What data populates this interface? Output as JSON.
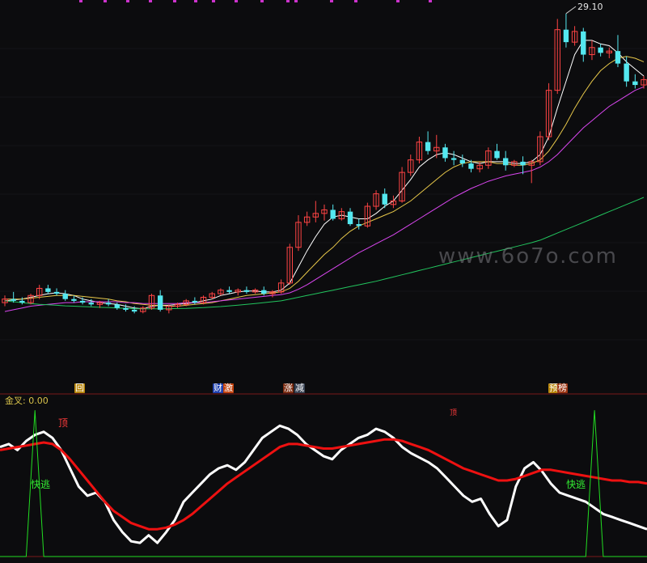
{
  "colors": {
    "background": "#0c0c0e",
    "up_candle": "#ff4444",
    "down_candle": "#54e8f0",
    "ma5": "#ffffff",
    "ma10": "#e8c84a",
    "ma20": "#d946ef",
    "ma60": "#22c55e",
    "signal_white": "#ffffff",
    "signal_red": "#ee1111",
    "escape_green": "#22dd22",
    "marker_magenta": "#cc33cc"
  },
  "price_panel": {
    "high_label": "29.10",
    "watermark": "www.6o7o.com",
    "tags": [
      {
        "text": "回",
        "bg": "#b8860b",
        "fg": "#ffffff"
      },
      {
        "text": "财",
        "bg": "#1e40af",
        "fg": "#ffffff"
      },
      {
        "text": "激",
        "bg": "#c2410c",
        "fg": "#ffffff"
      },
      {
        "text": "涨",
        "bg": "#7c2d12",
        "fg": "#ffffff"
      },
      {
        "text": "减",
        "bg": "#374151",
        "fg": "#ffffff"
      },
      {
        "text": "预",
        "bg": "#b8860b",
        "fg": "#ffffff"
      },
      {
        "text": "榜",
        "bg": "#9a3412",
        "fg": "#ffffff"
      }
    ]
  },
  "indicator_panel": {
    "title": "金叉: 0.00",
    "label_top": "顶",
    "label_top2": "顶",
    "label_escape": "快逃"
  },
  "chart_data": [
    {
      "type": "candlestick",
      "title": "",
      "ylabel": "",
      "ylim": [
        11.5,
        29.5
      ],
      "annotations": [
        "29.10"
      ],
      "candles": [
        {
          "o": 12.9,
          "h": 13.3,
          "l": 12.7,
          "c": 13.1
        },
        {
          "o": 13.1,
          "h": 13.5,
          "l": 12.9,
          "c": 13.0
        },
        {
          "o": 13.0,
          "h": 13.2,
          "l": 12.8,
          "c": 12.9
        },
        {
          "o": 12.9,
          "h": 13.4,
          "l": 12.8,
          "c": 13.3
        },
        {
          "o": 13.3,
          "h": 13.9,
          "l": 13.1,
          "c": 13.7
        },
        {
          "o": 13.7,
          "h": 13.9,
          "l": 13.4,
          "c": 13.5
        },
        {
          "o": 13.5,
          "h": 13.7,
          "l": 13.3,
          "c": 13.4
        },
        {
          "o": 13.4,
          "h": 13.6,
          "l": 13.0,
          "c": 13.1
        },
        {
          "o": 13.1,
          "h": 13.3,
          "l": 12.9,
          "c": 13.0
        },
        {
          "o": 13.0,
          "h": 13.2,
          "l": 12.8,
          "c": 12.9
        },
        {
          "o": 12.9,
          "h": 13.1,
          "l": 12.7,
          "c": 12.8
        },
        {
          "o": 12.8,
          "h": 13.0,
          "l": 12.6,
          "c": 12.9
        },
        {
          "o": 12.9,
          "h": 13.1,
          "l": 12.7,
          "c": 12.8
        },
        {
          "o": 12.8,
          "h": 12.9,
          "l": 12.5,
          "c": 12.6
        },
        {
          "o": 12.6,
          "h": 12.8,
          "l": 12.4,
          "c": 12.5
        },
        {
          "o": 12.5,
          "h": 12.7,
          "l": 12.3,
          "c": 12.4
        },
        {
          "o": 12.4,
          "h": 12.7,
          "l": 12.3,
          "c": 12.6
        },
        {
          "o": 12.6,
          "h": 13.4,
          "l": 12.5,
          "c": 13.3
        },
        {
          "o": 13.3,
          "h": 13.6,
          "l": 12.4,
          "c": 12.5
        },
        {
          "o": 12.5,
          "h": 12.8,
          "l": 12.3,
          "c": 12.7
        },
        {
          "o": 12.7,
          "h": 12.9,
          "l": 12.6,
          "c": 12.8
        },
        {
          "o": 12.8,
          "h": 13.1,
          "l": 12.7,
          "c": 13.0
        },
        {
          "o": 13.0,
          "h": 13.2,
          "l": 12.8,
          "c": 12.9
        },
        {
          "o": 12.9,
          "h": 13.3,
          "l": 12.8,
          "c": 13.2
        },
        {
          "o": 13.2,
          "h": 13.5,
          "l": 13.1,
          "c": 13.4
        },
        {
          "o": 13.4,
          "h": 13.7,
          "l": 13.3,
          "c": 13.6
        },
        {
          "o": 13.6,
          "h": 13.8,
          "l": 13.4,
          "c": 13.5
        },
        {
          "o": 13.5,
          "h": 13.7,
          "l": 13.3,
          "c": 13.6
        },
        {
          "o": 13.6,
          "h": 13.8,
          "l": 13.4,
          "c": 13.5
        },
        {
          "o": 13.5,
          "h": 13.7,
          "l": 13.4,
          "c": 13.6
        },
        {
          "o": 13.6,
          "h": 13.8,
          "l": 13.3,
          "c": 13.4
        },
        {
          "o": 13.4,
          "h": 13.6,
          "l": 13.2,
          "c": 13.5
        },
        {
          "o": 13.5,
          "h": 14.2,
          "l": 13.4,
          "c": 14.0
        },
        {
          "o": 14.0,
          "h": 16.2,
          "l": 13.9,
          "c": 16.0
        },
        {
          "o": 16.0,
          "h": 17.8,
          "l": 15.8,
          "c": 17.4
        },
        {
          "o": 17.4,
          "h": 18.0,
          "l": 17.2,
          "c": 17.7
        },
        {
          "o": 17.7,
          "h": 18.6,
          "l": 17.4,
          "c": 17.9
        },
        {
          "o": 17.9,
          "h": 18.4,
          "l": 17.5,
          "c": 18.1
        },
        {
          "o": 18.1,
          "h": 18.4,
          "l": 17.5,
          "c": 17.6
        },
        {
          "o": 17.6,
          "h": 18.2,
          "l": 17.5,
          "c": 18.0
        },
        {
          "o": 18.0,
          "h": 18.2,
          "l": 17.2,
          "c": 17.3
        },
        {
          "o": 17.3,
          "h": 17.6,
          "l": 17.0,
          "c": 17.2
        },
        {
          "o": 17.2,
          "h": 18.5,
          "l": 17.1,
          "c": 18.3
        },
        {
          "o": 18.3,
          "h": 19.2,
          "l": 18.1,
          "c": 19.0
        },
        {
          "o": 19.0,
          "h": 19.3,
          "l": 18.2,
          "c": 18.4
        },
        {
          "o": 18.4,
          "h": 18.9,
          "l": 18.2,
          "c": 18.6
        },
        {
          "o": 18.6,
          "h": 20.5,
          "l": 18.5,
          "c": 20.2
        },
        {
          "o": 20.2,
          "h": 21.2,
          "l": 20.0,
          "c": 20.9
        },
        {
          "o": 20.9,
          "h": 22.2,
          "l": 20.7,
          "c": 21.9
        },
        {
          "o": 21.9,
          "h": 22.5,
          "l": 21.2,
          "c": 21.4
        },
        {
          "o": 21.4,
          "h": 22.3,
          "l": 21.0,
          "c": 21.6
        },
        {
          "o": 21.6,
          "h": 21.8,
          "l": 20.8,
          "c": 21.0
        },
        {
          "o": 21.0,
          "h": 21.4,
          "l": 20.6,
          "c": 20.9
        },
        {
          "o": 20.9,
          "h": 21.2,
          "l": 20.5,
          "c": 20.7
        },
        {
          "o": 20.7,
          "h": 20.9,
          "l": 20.2,
          "c": 20.4
        },
        {
          "o": 20.4,
          "h": 20.8,
          "l": 20.2,
          "c": 20.6
        },
        {
          "o": 20.6,
          "h": 21.6,
          "l": 20.4,
          "c": 21.4
        },
        {
          "o": 21.4,
          "h": 21.8,
          "l": 20.9,
          "c": 21.0
        },
        {
          "o": 21.0,
          "h": 21.4,
          "l": 20.3,
          "c": 20.6
        },
        {
          "o": 20.6,
          "h": 20.9,
          "l": 20.5,
          "c": 20.8
        },
        {
          "o": 20.8,
          "h": 21.1,
          "l": 20.1,
          "c": 20.6
        },
        {
          "o": 20.6,
          "h": 20.9,
          "l": 19.6,
          "c": 20.8
        },
        {
          "o": 20.8,
          "h": 22.5,
          "l": 20.6,
          "c": 22.2
        },
        {
          "o": 22.2,
          "h": 25.2,
          "l": 22.0,
          "c": 24.8
        },
        {
          "o": 24.8,
          "h": 28.8,
          "l": 24.6,
          "c": 28.2
        },
        {
          "o": 28.2,
          "h": 29.1,
          "l": 27.2,
          "c": 27.5
        },
        {
          "o": 27.5,
          "h": 28.4,
          "l": 27.3,
          "c": 28.1
        },
        {
          "o": 28.1,
          "h": 28.3,
          "l": 26.4,
          "c": 26.8
        },
        {
          "o": 26.8,
          "h": 27.6,
          "l": 26.5,
          "c": 27.2
        },
        {
          "o": 27.2,
          "h": 27.4,
          "l": 26.7,
          "c": 26.9
        },
        {
          "o": 26.9,
          "h": 27.2,
          "l": 26.6,
          "c": 27.0
        },
        {
          "o": 27.0,
          "h": 27.9,
          "l": 26.1,
          "c": 26.3
        },
        {
          "o": 26.3,
          "h": 26.7,
          "l": 25.0,
          "c": 25.3
        },
        {
          "o": 25.3,
          "h": 25.7,
          "l": 24.9,
          "c": 25.1
        },
        {
          "o": 25.1,
          "h": 25.6,
          "l": 24.9,
          "c": 25.4
        }
      ],
      "series": [
        {
          "name": "",
          "color": "#ffffff",
          "values": [
            13.0,
            13.05,
            13.1,
            13.2,
            13.3,
            13.4,
            13.45,
            13.4,
            13.3,
            13.1,
            13.0,
            12.9,
            12.85,
            12.8,
            12.7,
            12.6,
            12.55,
            12.7,
            12.75,
            12.75,
            12.8,
            12.85,
            12.9,
            13.0,
            13.1,
            13.3,
            13.4,
            13.5,
            13.55,
            13.55,
            13.5,
            13.5,
            13.6,
            14.0,
            14.9,
            15.8,
            16.6,
            17.3,
            17.7,
            17.8,
            17.7,
            17.6,
            17.6,
            17.9,
            18.3,
            18.6,
            19.2,
            19.8,
            20.5,
            20.9,
            21.2,
            21.3,
            21.2,
            21.0,
            20.8,
            20.7,
            20.8,
            20.8,
            20.8,
            20.7,
            20.7,
            20.8,
            21.2,
            22.2,
            23.8,
            25.3,
            26.8,
            27.6,
            27.6,
            27.4,
            27.3,
            26.9,
            26.4,
            26.0,
            25.6
          ]
        },
        {
          "name": "",
          "color": "#e8c84a",
          "values": [
            13.1,
            13.1,
            13.1,
            13.15,
            13.2,
            13.25,
            13.3,
            13.3,
            13.3,
            13.25,
            13.2,
            13.15,
            13.1,
            13.0,
            12.95,
            12.85,
            12.8,
            12.75,
            12.75,
            12.7,
            12.7,
            12.75,
            12.8,
            12.85,
            12.9,
            13.0,
            13.1,
            13.2,
            13.3,
            13.35,
            13.4,
            13.45,
            13.5,
            13.7,
            14.1,
            14.6,
            15.1,
            15.6,
            16.0,
            16.5,
            16.9,
            17.2,
            17.4,
            17.6,
            17.8,
            18.0,
            18.3,
            18.6,
            19.0,
            19.4,
            19.8,
            20.2,
            20.5,
            20.7,
            20.8,
            20.8,
            20.8,
            20.7,
            20.7,
            20.6,
            20.6,
            20.7,
            20.9,
            21.4,
            22.1,
            22.9,
            23.8,
            24.6,
            25.3,
            25.9,
            26.3,
            26.6,
            26.7,
            26.6,
            26.4
          ]
        },
        {
          "name": "",
          "color": "#d946ef",
          "values": [
            12.4,
            12.5,
            12.6,
            12.7,
            12.75,
            12.8,
            12.85,
            12.9,
            12.9,
            12.95,
            12.95,
            12.95,
            12.95,
            12.95,
            12.9,
            12.9,
            12.85,
            12.85,
            12.85,
            12.85,
            12.85,
            12.9,
            12.9,
            12.9,
            12.95,
            13.0,
            13.05,
            13.1,
            13.15,
            13.2,
            13.25,
            13.3,
            13.35,
            13.45,
            13.65,
            13.9,
            14.2,
            14.5,
            14.8,
            15.1,
            15.4,
            15.7,
            15.95,
            16.2,
            16.45,
            16.7,
            17.0,
            17.3,
            17.6,
            17.9,
            18.2,
            18.5,
            18.8,
            19.05,
            19.3,
            19.5,
            19.7,
            19.85,
            20.0,
            20.1,
            20.2,
            20.3,
            20.5,
            20.8,
            21.2,
            21.7,
            22.2,
            22.7,
            23.1,
            23.5,
            23.9,
            24.2,
            24.5,
            24.8,
            25.0
          ]
        },
        {
          "name": "",
          "color": "#22c55e",
          "values": [
            13.0,
            12.95,
            12.9,
            12.85,
            12.8,
            12.78,
            12.75,
            12.72,
            12.7,
            12.68,
            12.66,
            12.64,
            12.62,
            12.6,
            12.58,
            12.56,
            12.55,
            12.55,
            12.55,
            12.56,
            12.57,
            12.58,
            12.6,
            12.62,
            12.65,
            12.68,
            12.72,
            12.76,
            12.8,
            12.85,
            12.9,
            12.95,
            13.0,
            13.1,
            13.2,
            13.3,
            13.4,
            13.5,
            13.6,
            13.7,
            13.8,
            13.9,
            14.0,
            14.1,
            14.22,
            14.34,
            14.46,
            14.58,
            14.7,
            14.82,
            14.94,
            15.06,
            15.18,
            15.3,
            15.42,
            15.54,
            15.66,
            15.78,
            15.9,
            16.02,
            16.14,
            16.26,
            16.4,
            16.6,
            16.8,
            17.0,
            17.2,
            17.4,
            17.6,
            17.8,
            18.0,
            18.2,
            18.4,
            18.6,
            18.8
          ]
        }
      ]
    },
    {
      "type": "line",
      "title": "金叉: 0.00",
      "ylim": [
        0,
        100
      ],
      "x_count": 75,
      "series": [
        {
          "name": "",
          "color": "#ffffff",
          "values": [
            72,
            74,
            70,
            76,
            80,
            82,
            78,
            70,
            58,
            46,
            40,
            42,
            36,
            24,
            16,
            10,
            9,
            14,
            9,
            16,
            24,
            36,
            42,
            48,
            54,
            58,
            60,
            57,
            62,
            70,
            78,
            82,
            86,
            84,
            80,
            74,
            70,
            66,
            64,
            70,
            74,
            78,
            80,
            84,
            82,
            78,
            72,
            68,
            65,
            62,
            58,
            52,
            46,
            40,
            36,
            38,
            28,
            20,
            24,
            46,
            58,
            62,
            56,
            48,
            42,
            40,
            38,
            36,
            32,
            28,
            26,
            24,
            22,
            20,
            18
          ]
        },
        {
          "name": "",
          "color": "#ee1111",
          "values": [
            70,
            71,
            72,
            73,
            74,
            75,
            74,
            70,
            64,
            57,
            50,
            43,
            36,
            30,
            26,
            22,
            20,
            18,
            18,
            19,
            21,
            24,
            28,
            33,
            38,
            43,
            48,
            52,
            56,
            60,
            64,
            68,
            72,
            74,
            74,
            73,
            72,
            71,
            71,
            72,
            73,
            74,
            75,
            76,
            77,
            77,
            76,
            74,
            72,
            70,
            67,
            64,
            61,
            58,
            56,
            54,
            52,
            50,
            50,
            51,
            53,
            55,
            57,
            57,
            56,
            55,
            54,
            53,
            52,
            51,
            50,
            50,
            49,
            49,
            48
          ]
        },
        {
          "name": "",
          "color": "#22dd22",
          "values": [
            0,
            0,
            0,
            0,
            96,
            0,
            0,
            0,
            0,
            0,
            0,
            0,
            0,
            0,
            0,
            0,
            0,
            0,
            0,
            0,
            0,
            0,
            0,
            0,
            0,
            0,
            0,
            0,
            0,
            0,
            0,
            0,
            0,
            0,
            0,
            0,
            0,
            0,
            0,
            0,
            0,
            0,
            0,
            0,
            0,
            0,
            0,
            0,
            0,
            0,
            0,
            0,
            0,
            0,
            0,
            0,
            0,
            0,
            0,
            0,
            0,
            0,
            0,
            0,
            0,
            0,
            0,
            0,
            96,
            0,
            0,
            0,
            0,
            0,
            0
          ]
        }
      ],
      "annotations": [
        "顶",
        "顶",
        "快逃",
        "快逃"
      ]
    }
  ]
}
